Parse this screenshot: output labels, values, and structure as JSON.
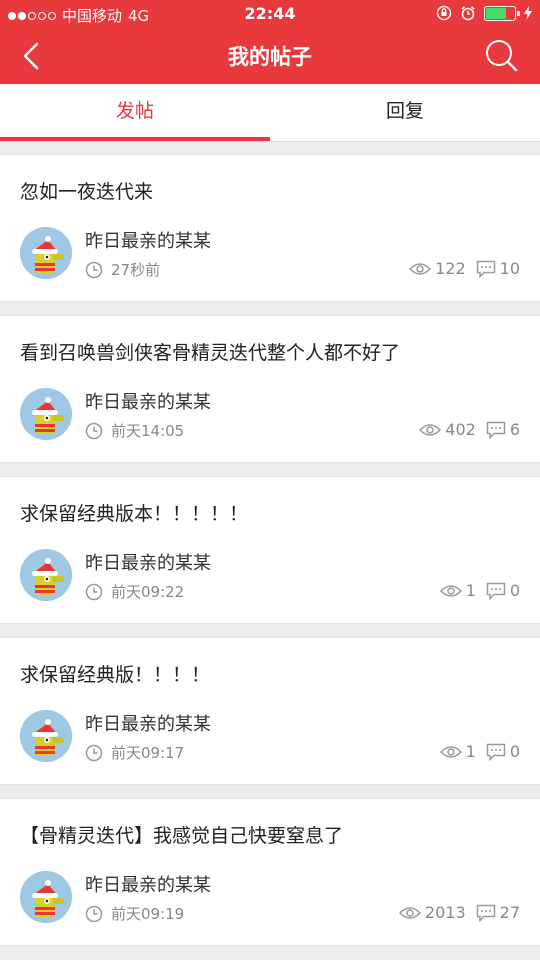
{
  "status": {
    "carrier": "中国移动",
    "network": "4G",
    "time": "22:44"
  },
  "header": {
    "title": "我的帖子"
  },
  "tabs": [
    {
      "label": "发帖"
    },
    {
      "label": "回复"
    }
  ],
  "posts": [
    {
      "title": "忽如一夜迭代来",
      "author": "昨日最亲的某某",
      "time": "27秒前",
      "views": "122",
      "comments": "10"
    },
    {
      "title": "看到召唤兽剑侠客骨精灵迭代整个人都不好了",
      "author": "昨日最亲的某某",
      "time": "前天14:05",
      "views": "402",
      "comments": "6"
    },
    {
      "title": "求保留经典版本！！！！！",
      "author": "昨日最亲的某某",
      "time": "前天09:22",
      "views": "1",
      "comments": "0"
    },
    {
      "title": "求保留经典版！！！！",
      "author": "昨日最亲的某某",
      "time": "前天09:17",
      "views": "1",
      "comments": "0"
    },
    {
      "title": "【骨精灵迭代】我感觉自己快要窒息了",
      "author": "昨日最亲的某某",
      "time": "前天09:19",
      "views": "2013",
      "comments": "27"
    }
  ],
  "colors": {
    "accent": "#e8393c",
    "background": "#ececec"
  },
  "icons": [
    "back-arrow-icon",
    "search-icon",
    "clock-icon",
    "eye-icon",
    "comment-icon",
    "alarm-icon",
    "lock-rotation-icon",
    "charging-icon"
  ]
}
